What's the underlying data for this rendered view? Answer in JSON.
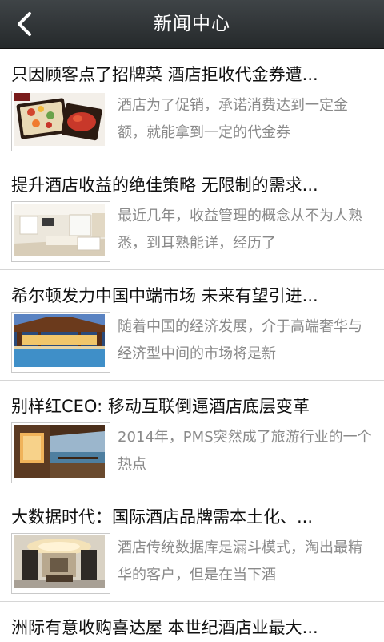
{
  "header": {
    "title": "新闻中心",
    "back_icon": "chevron-left-icon"
  },
  "colors": {
    "header_bg": "#2f3436",
    "title_text": "#111111",
    "summary_text": "#8a8a8a",
    "divider": "#d6d6d6"
  },
  "news": [
    {
      "title": "只因顾客点了招牌菜 酒店拒收代金券遭...",
      "summary": "酒店为了促销，承诺消费达到一定金额，就能拿到一定的代金券",
      "thumb": "food-platter-image"
    },
    {
      "title": "提升酒店收益的绝佳策略 无限制的需求...",
      "summary": "最近几年，收益管理的概念从不为人熟悉，到耳熟能详，经历了",
      "thumb": "hotel-room-image"
    },
    {
      "title": "希尔顿发力中国中端市场 未来有望引进...",
      "summary": "随着中国的经济发展，介于高端奢华与经济型中间的市场将是新",
      "thumb": "resort-pool-image"
    },
    {
      "title": "别样红CEO: 移动互联倒逼酒店底层变革",
      "summary": "2014年，PMS突然成了旅游行业的一个热点",
      "thumb": "resort-terrace-image"
    },
    {
      "title": "大数据时代：国际酒店品牌需本土化、...",
      "summary": "酒店传统数据库是漏斗模式，淘出最精华的客户，但是在当下酒",
      "thumb": "hotel-lobby-image"
    },
    {
      "title": "洲际有意收购喜达屋 本世纪酒店业最大..."
    }
  ]
}
